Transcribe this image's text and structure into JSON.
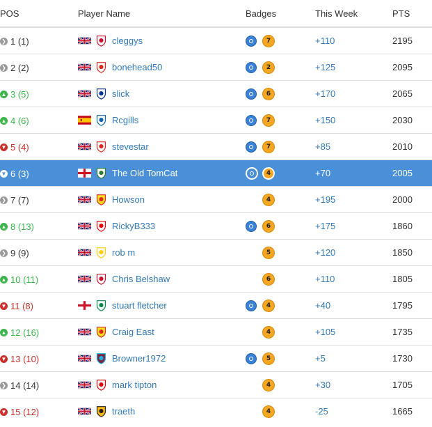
{
  "headers": {
    "pos": "POS",
    "player": "Player Name",
    "badges": "Badges",
    "week": "This Week",
    "pts": "PTS"
  },
  "colors": {
    "up": "#3ab54a",
    "down": "#c9302c",
    "same": "#999999",
    "link": "#337ab7",
    "highlight": "#4a90d9",
    "badge_blue": "#3b82d6",
    "badge_orange": "#f5a623"
  },
  "rows": [
    {
      "pos": "1 (1)",
      "move": "same",
      "flag": "uk",
      "crest": "liverpool",
      "name": "cleggys",
      "blue_badge": true,
      "orange_badge": "7",
      "week": "+110",
      "pts": "2195"
    },
    {
      "pos": "2 (2)",
      "move": "same",
      "flag": "uk",
      "crest": "bournemouth",
      "name": "bonehead50",
      "blue_badge": true,
      "orange_badge": "2",
      "week": "+125",
      "pts": "2095"
    },
    {
      "pos": "3 (5)",
      "move": "up",
      "flag": "uk",
      "crest": "leicester",
      "name": "slick",
      "blue_badge": true,
      "orange_badge": "6",
      "week": "+170",
      "pts": "2065"
    },
    {
      "pos": "4 (6)",
      "move": "up",
      "flag": "es",
      "crest": "huddersfield",
      "name": "Rcgills",
      "blue_badge": true,
      "orange_badge": "7",
      "week": "+150",
      "pts": "2030"
    },
    {
      "pos": "5 (4)",
      "move": "down",
      "flag": "uk",
      "crest": "bournemouth",
      "name": "stevestar",
      "blue_badge": true,
      "orange_badge": "7",
      "week": "+85",
      "pts": "2010"
    },
    {
      "pos": "6 (3)",
      "move": "down",
      "flag": "en",
      "crest": "yeovil",
      "name": "The Old TomCat",
      "blue_badge": true,
      "orange_badge": "4",
      "week": "+70",
      "pts": "2005",
      "highlight": true
    },
    {
      "pos": "7 (7)",
      "move": "same",
      "flag": "uk",
      "crest": "man-utd",
      "name": "Howson",
      "blue_badge": false,
      "orange_badge": "4",
      "week": "+195",
      "pts": "2000"
    },
    {
      "pos": "8 (13)",
      "move": "up",
      "flag": "uk",
      "crest": "arsenal",
      "name": "RickyB333",
      "blue_badge": true,
      "orange_badge": "6",
      "week": "+175",
      "pts": "1860"
    },
    {
      "pos": "9 (9)",
      "move": "same",
      "flag": "uk",
      "crest": "leeds",
      "name": "rob m",
      "blue_badge": false,
      "orange_badge": "5",
      "week": "+120",
      "pts": "1850"
    },
    {
      "pos": "10 (11)",
      "move": "up",
      "flag": "uk",
      "crest": "liverpool",
      "name": "Chris Belshaw",
      "blue_badge": false,
      "orange_badge": "6",
      "week": "+110",
      "pts": "1805"
    },
    {
      "pos": "11 (8)",
      "move": "down",
      "flag": "en",
      "crest": "celtic",
      "name": "stuart fletcher",
      "blue_badge": true,
      "orange_badge": "4",
      "week": "+40",
      "pts": "1795"
    },
    {
      "pos": "12 (16)",
      "move": "up",
      "flag": "uk",
      "crest": "man-utd",
      "name": "Craig East",
      "blue_badge": false,
      "orange_badge": "4",
      "week": "+105",
      "pts": "1735"
    },
    {
      "pos": "13 (10)",
      "move": "down",
      "flag": "uk",
      "crest": "west-ham",
      "name": "Browner1972",
      "blue_badge": true,
      "orange_badge": "5",
      "week": "+5",
      "pts": "1730"
    },
    {
      "pos": "14 (14)",
      "move": "same",
      "flag": "uk",
      "crest": "nottingham-forest",
      "name": "mark tipton",
      "blue_badge": false,
      "orange_badge": "4",
      "week": "+30",
      "pts": "1705"
    },
    {
      "pos": "15 (12)",
      "move": "down",
      "flag": "uk",
      "crest": "wolves",
      "name": "traeth",
      "blue_badge": false,
      "orange_badge": "4",
      "week": "-25",
      "pts": "1665"
    }
  ]
}
